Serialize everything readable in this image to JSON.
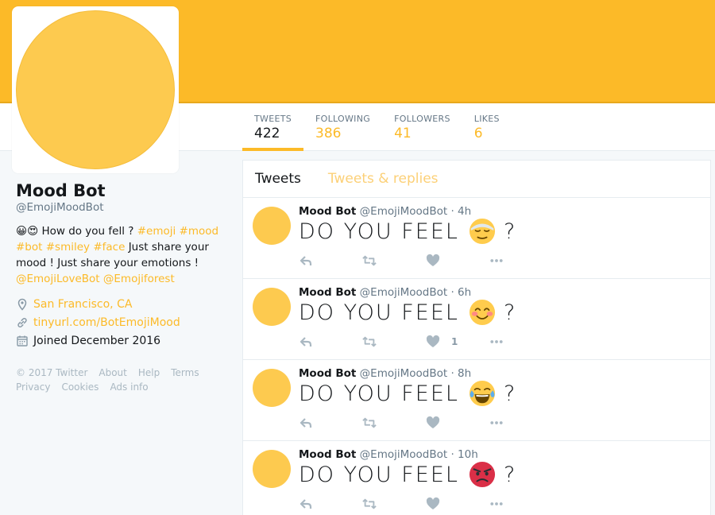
{
  "profile": {
    "name": "Mood Bot",
    "handle": "@EmojiMoodBot",
    "bio": {
      "emoji": "😀😍",
      "intro": " How do you fell ? ",
      "tags": [
        "#emoji",
        "#mood",
        "#bot",
        "#smiley",
        "#face"
      ],
      "text": " Just share your mood ! Just share your emotions ! ",
      "mention1": "@EmojiLoveBot",
      "mention2": "@Emojiforest"
    },
    "location": "San Francisco, CA",
    "url": "tinyurl.com/BotEmojiMood",
    "joined": "Joined December 2016"
  },
  "stats": [
    {
      "label": "TWEETS",
      "value": "422"
    },
    {
      "label": "FOLLOWING",
      "value": "386"
    },
    {
      "label": "FOLLOWERS",
      "value": "41"
    },
    {
      "label": "LIKES",
      "value": "6"
    }
  ],
  "footer": {
    "copyright": "© 2017 Twitter",
    "about": "About",
    "help": "Help",
    "terms": "Terms",
    "privacy": "Privacy",
    "cookies": "Cookies",
    "ads": "Ads info"
  },
  "tabs": {
    "tweets": "Tweets",
    "replies": "Tweets & replies"
  },
  "tweets": [
    {
      "name": "Mood Bot",
      "handle": "@EmojiMoodBot",
      "time": "· 4h",
      "prefix": "DO YOU FEEL",
      "emoji": "relieved-face",
      "suffix": "?",
      "likes": ""
    },
    {
      "name": "Mood Bot",
      "handle": "@EmojiMoodBot",
      "time": "· 6h",
      "prefix": "DO YOU FEEL",
      "emoji": "smiling-blush-face",
      "suffix": "?",
      "likes": "1"
    },
    {
      "name": "Mood Bot",
      "handle": "@EmojiMoodBot",
      "time": "· 8h",
      "prefix": "DO YOU FEEL",
      "emoji": "tears-of-joy-face",
      "suffix": "?",
      "likes": ""
    },
    {
      "name": "Mood Bot",
      "handle": "@EmojiMoodBot",
      "time": "· 10h",
      "prefix": "DO YOU FEEL",
      "emoji": "angry-face",
      "suffix": "?",
      "likes": ""
    }
  ],
  "colors": {
    "accent": "#fcba28",
    "avatar": "#fdca4f"
  }
}
